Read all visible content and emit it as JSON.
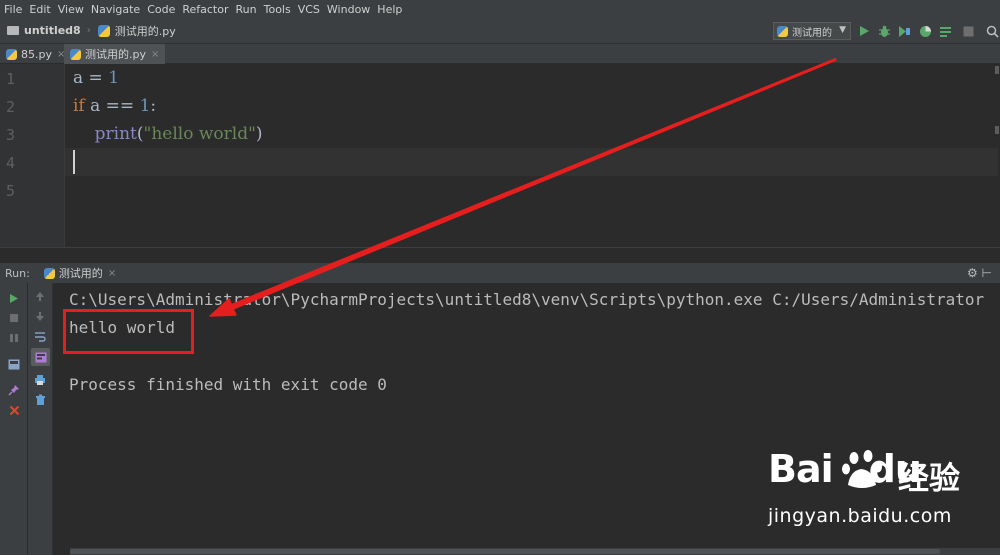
{
  "menu": [
    "File",
    "Edit",
    "View",
    "Navigate",
    "Code",
    "Refactor",
    "Run",
    "Tools",
    "VCS",
    "Window",
    "Help"
  ],
  "breadcrumb": {
    "project": "untitled8",
    "file": "测试用的.py"
  },
  "toolbar": {
    "run_config": "测试用的"
  },
  "tabs": [
    {
      "label": "85.py",
      "active": false
    },
    {
      "label": "测试用的.py",
      "active": true
    }
  ],
  "editor": {
    "line_numbers": [
      "1",
      "2",
      "3",
      "4",
      "5"
    ],
    "line1": {
      "var": "a",
      "op": " = ",
      "num": "1"
    },
    "line2": {
      "kw": "if",
      "rest": " a == ",
      "num": "1",
      "colon": ":"
    },
    "line3": {
      "indent": "    ",
      "fn": "print",
      "open": "(",
      "str": "\"hello world\"",
      "close": ")"
    }
  },
  "run_panel": {
    "label": "Run:",
    "tab": "测试用的"
  },
  "console": {
    "command": "C:\\Users\\Administrator\\PycharmProjects\\untitled8\\venv\\Scripts\\python.exe C:/Users/Administrator",
    "output": "hello world",
    "exit": "Process finished with exit code 0"
  },
  "watermark": {
    "brand": "Bai",
    "brand_tail": "du",
    "cn": "经验",
    "url": "jingyan.baidu.com"
  },
  "colors": {
    "annotation": "#e61e1e",
    "keyword": "#cc7832",
    "number": "#6897bb",
    "string": "#6a8759",
    "builtin": "#8888c6"
  },
  "icons": [
    "folder-icon",
    "python-file-icon",
    "run-icon",
    "debug-icon",
    "coverage-icon",
    "profile-icon",
    "concurrency-icon",
    "stop-icon",
    "search-icon",
    "gear-icon",
    "close-icon"
  ]
}
